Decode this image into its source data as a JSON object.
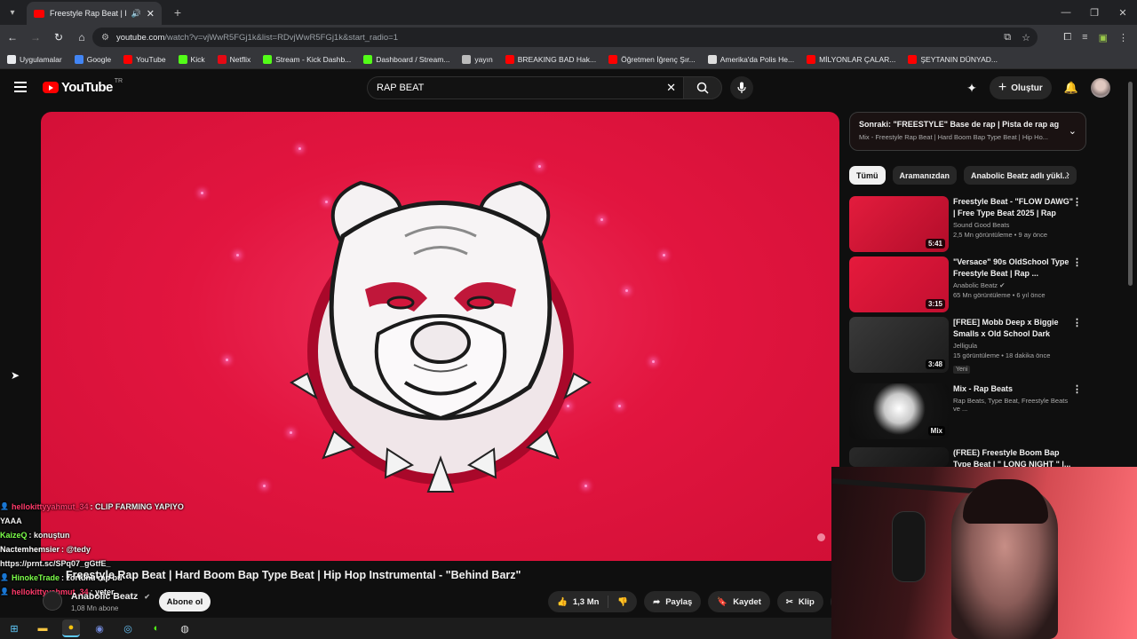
{
  "browser": {
    "tab_title": "Freestyle Rap Beat | Hard B...",
    "new_tab": "+",
    "url_host": "youtube.com",
    "url_path": "/watch?v=vjWwR5FGj1k&list=RDvjWwR5FGj1k&start_radio=1",
    "bookmarks": [
      {
        "label": "Uygulamalar",
        "color": "#e8eaed"
      },
      {
        "label": "Google",
        "color": "#4285f4"
      },
      {
        "label": "YouTube",
        "color": "#ff0000"
      },
      {
        "label": "Kick",
        "color": "#53fc18"
      },
      {
        "label": "Netflix",
        "color": "#e50914"
      },
      {
        "label": "Stream - Kick Dashb...",
        "color": "#53fc18"
      },
      {
        "label": "Dashboard / Stream...",
        "color": "#53fc18"
      },
      {
        "label": "yayın",
        "color": "#bbbbbb"
      },
      {
        "label": "BREAKING BAD Hak...",
        "color": "#ff0000"
      },
      {
        "label": "Öğretmen İğrenç Şır...",
        "color": "#ff0000"
      },
      {
        "label": "Amerika'da Polis He...",
        "color": "#dddddd"
      },
      {
        "label": "MİLYONLAR ÇALAR...",
        "color": "#ff0000"
      },
      {
        "label": "ŞEYTANIN DÜNYAD...",
        "color": "#ff0000"
      }
    ]
  },
  "header": {
    "logo_text": "YouTube",
    "logo_region": "TR",
    "search_value": "RAP BEAT",
    "create_label": "Oluştur"
  },
  "video": {
    "title": "Freestyle Rap Beat | Hard Boom Bap Type Beat | Hip Hop Instrumental - \"Behind Barz\"",
    "channel": "Anabolic Beatz",
    "subscribers": "1,08 Mn abone",
    "subscribe_label": "Abone ol",
    "likes": "1,3 Mn",
    "share_label": "Paylaş",
    "save_label": "Kaydet",
    "clip_label": "Klip",
    "accent_color": "#e2153f"
  },
  "chat": [
    {
      "user": "hellokittyyahmut_34",
      "user_color": "#ff3b6b",
      "text": ": CLIP FARMING YAPIYO",
      "badge": true
    },
    {
      "user": "",
      "user_color": "#ffffff",
      "text": "YAAA",
      "badge": false
    },
    {
      "user": "KaizeQ",
      "user_color": "#7cff4a",
      "text": ": konuştun",
      "badge": false
    },
    {
      "user": "Nactemhemsier",
      "user_color": "#ffffff",
      "text": ": @tedy",
      "badge": false
    },
    {
      "user": "",
      "user_color": "#ffffff",
      "text": "https://prnt.sc/SPq07_gGtfE_",
      "badge": false
    },
    {
      "user": "HinokeTrade",
      "user_color": "#7cff4a",
      "text": ": zortunu rap bu",
      "badge": true
    },
    {
      "user": "hellokittyyahmut_34",
      "user_color": "#ff3b6b",
      "text": ": yeter",
      "badge": true
    }
  ],
  "sidebar": {
    "up_next_title": "Sonraki: \"FREESTYLE\" Base de rap | Pista de rap ag...",
    "up_next_sub": "Mix - Freestyle Rap Beat | Hard Boom Bap Type Beat | Hip Ho...",
    "chips": [
      "Tümü",
      "Aramanızdan",
      "Anabolic Beatz adlı yükl..."
    ],
    "items": [
      {
        "title": "Freestyle Beat - \"FLOW DAWG\" | Free Type Beat 2025 | Rap Tra...",
        "channel": "Sound Good Beats",
        "meta": "2,5 Mn görüntüleme • 9 ay önce",
        "duration": "5:41",
        "badge": "",
        "verified": false
      },
      {
        "title": "\"Versace\" 90s OldSchool Type Freestyle Beat | Rap ...",
        "channel": "Anabolic Beatz",
        "meta": "65 Mn görüntüleme • 6 yıl önce",
        "duration": "3:15",
        "badge": "",
        "verified": true
      },
      {
        "title": "[FREE] Mobb Deep x Biggie Smalls x Old School Dark Boo...",
        "channel": "Jelligula",
        "meta": "15 görüntüleme • 18 dakika önce",
        "duration": "3:48",
        "badge": "Yeni",
        "verified": false
      },
      {
        "title": "Mix - Rap Beats",
        "channel": "Rap Beats, Type Beat, Freestyle Beats ve ...",
        "meta": "",
        "duration": "Mix",
        "badge": "",
        "verified": false
      },
      {
        "title": "(FREE) Freestyle Boom Bap Type Beat | \" LONG NIGHT \" |...",
        "channel": "",
        "meta": "",
        "duration": "",
        "badge": "",
        "verified": false
      }
    ]
  }
}
